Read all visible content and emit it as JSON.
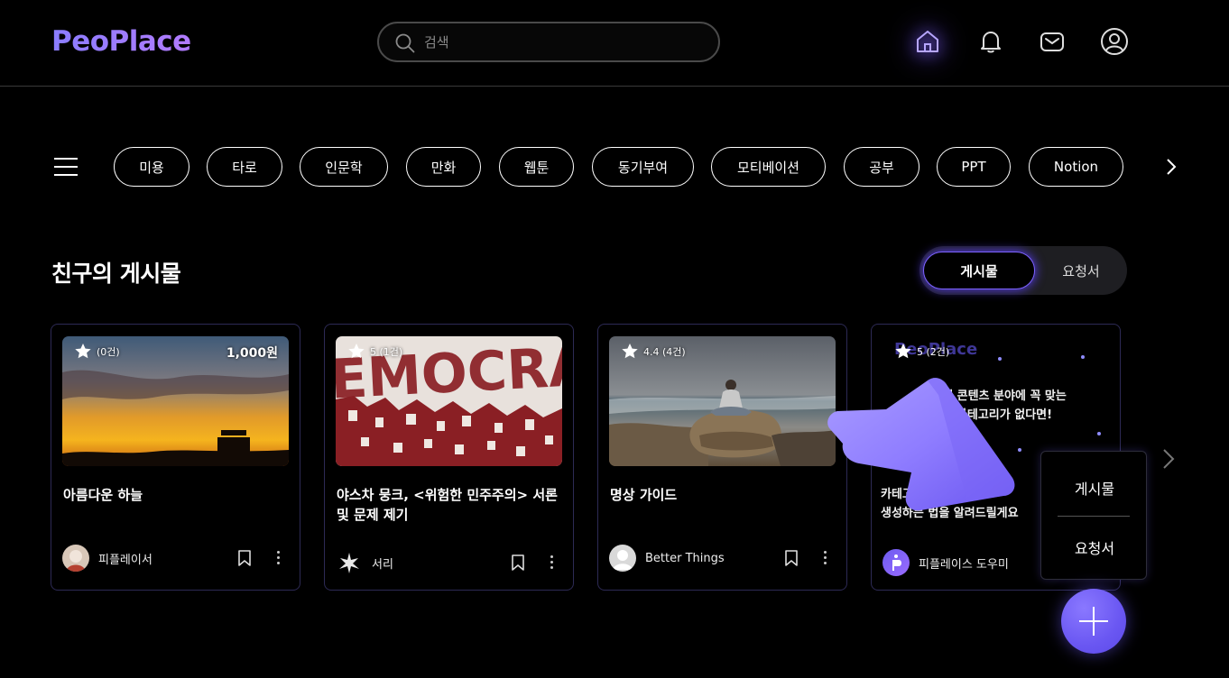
{
  "header": {
    "logo": "PeoPlace",
    "search_placeholder": "검색",
    "icons": [
      "home-icon",
      "bell-icon",
      "mail-icon",
      "user-icon"
    ]
  },
  "categories": [
    "미용",
    "타로",
    "인문학",
    "만화",
    "웹툰",
    "동기부여",
    "모티베이션",
    "공부",
    "PPT",
    "Notion"
  ],
  "section": {
    "title": "친구의 게시물",
    "toggle": {
      "active": "게시물",
      "inactive": "요청서"
    }
  },
  "cards": [
    {
      "rating": "(0건)",
      "price": "1,000원",
      "title": "아름다운 하늘",
      "author": "피플레이서"
    },
    {
      "rating": "5 (1건)",
      "price": "",
      "title": "야스차 뭉크, <위험한 민주주의> 서론 및 문제 제기",
      "author": "서리"
    },
    {
      "rating": "4.4 (4건)",
      "price": "",
      "title": "명상 가이드",
      "author": "Better Things"
    },
    {
      "rating": "5 (2건)",
      "price": "",
      "title": "",
      "author": "피플레이스 도우미",
      "promo_lines": [
        "내 콘텐츠 분야에 꼭 맞는",
        "카테고리가 없다면!",
        "카테고리를",
        "생성하는 법을 알려드릴게요"
      ]
    }
  ],
  "popup": {
    "post": "게시물",
    "request": "요청서"
  },
  "colors": {
    "accent": "#7d63ff",
    "card_border": "#2d2a55",
    "fab": "#6a57f2"
  }
}
